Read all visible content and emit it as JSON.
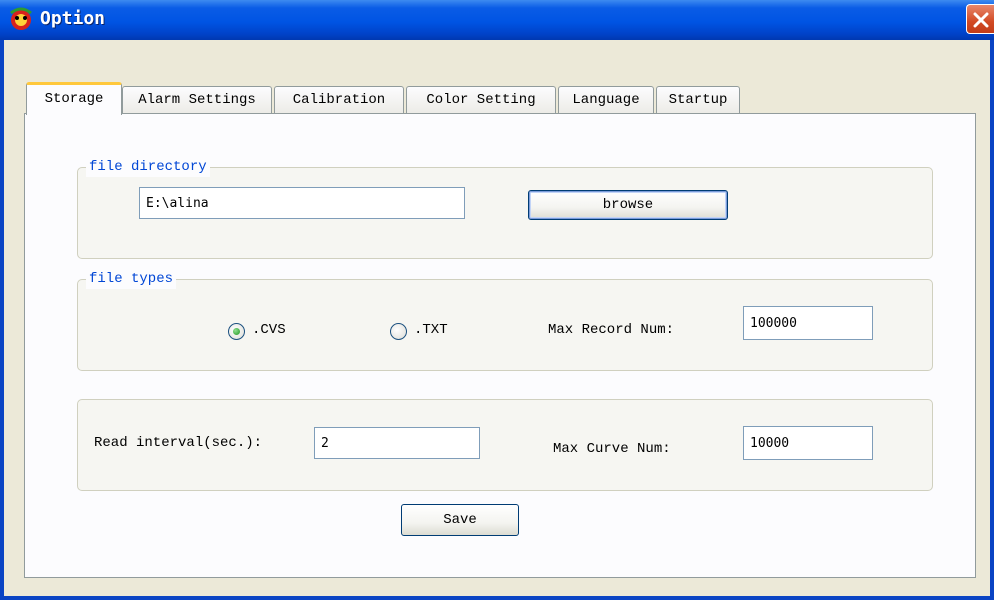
{
  "window": {
    "title": "Option",
    "close_icon": "close-icon"
  },
  "tabs": [
    {
      "label": "Storage",
      "active": true
    },
    {
      "label": "Alarm Settings",
      "active": false
    },
    {
      "label": "Calibration",
      "active": false
    },
    {
      "label": "Color Setting",
      "active": false
    },
    {
      "label": "Language",
      "active": false
    },
    {
      "label": "Startup",
      "active": false
    }
  ],
  "file_directory": {
    "legend": "file directory",
    "path_value": "E:\\alina",
    "browse_label": "browse"
  },
  "file_types": {
    "legend": "file types",
    "options": [
      {
        "label": ".CVS",
        "selected": true
      },
      {
        "label": ".TXT",
        "selected": false
      }
    ],
    "max_record_label": "Max Record Num:",
    "max_record_value": "100000"
  },
  "interval": {
    "read_interval_label": "Read interval(sec.):",
    "read_interval_value": "2",
    "max_curve_label": "Max Curve Num:",
    "max_curve_value": "10000"
  },
  "save_label": "Save",
  "colors": {
    "titlebar": "#0054e3",
    "legend": "#0046d5",
    "active_tab_accent": "#ffc83c",
    "close_button": "#d24a24"
  }
}
